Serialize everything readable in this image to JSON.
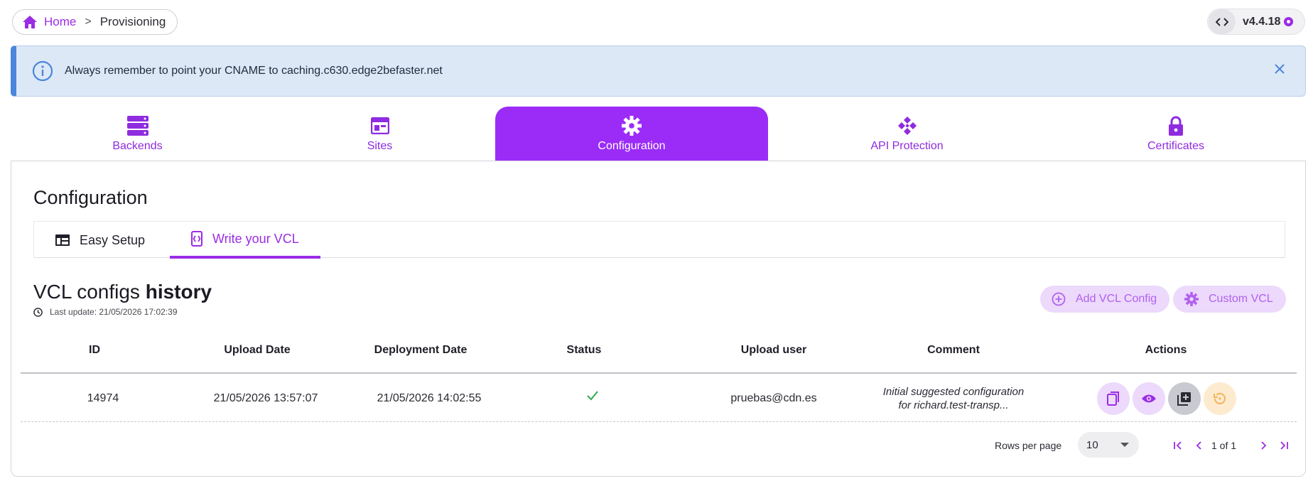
{
  "breadcrumb": {
    "home": "Home",
    "separator": ">",
    "current": "Provisioning"
  },
  "version": {
    "label": "v4.4.18"
  },
  "alert": {
    "text": "Always remember to point your CNAME to caching.c630.edge2befaster.net"
  },
  "tabs": [
    {
      "label": "Backends",
      "icon": "server-icon"
    },
    {
      "label": "Sites",
      "icon": "browser-window-icon"
    },
    {
      "label": "Configuration",
      "icon": "gear-icon",
      "active": true
    },
    {
      "label": "API Protection",
      "icon": "api-protection-icon"
    },
    {
      "label": "Certificates",
      "icon": "lock-icon"
    }
  ],
  "section": {
    "title": "Configuration"
  },
  "subtabs": [
    {
      "label": "Easy Setup",
      "icon": "table-layout-icon"
    },
    {
      "label": "Write your VCL",
      "icon": "code-file-icon",
      "active": true
    }
  ],
  "history": {
    "title_light": "VCL configs",
    "title_bold": "history",
    "last_update": "Last update: 21/05/2026 17:02:39"
  },
  "buttons": {
    "add": "Add VCL Config",
    "custom": "Custom VCL"
  },
  "table": {
    "columns": [
      "ID",
      "Upload Date",
      "Deployment Date",
      "Status",
      "Upload user",
      "Comment",
      "Actions"
    ],
    "rows": [
      {
        "id": "14974",
        "upload_date": "21/05/2026 13:57:07",
        "deployment_date": "21/05/2026 14:02:55",
        "status": "deployed",
        "user": "pruebas@cdn.es",
        "comment_line1": "Initial suggested configuration",
        "comment_line2": "for richard.test-transp..."
      }
    ]
  },
  "pagination": {
    "rows_label": "Rows per page",
    "rows_value": "10",
    "page_text": "1 of 1"
  },
  "colors": {
    "accent": "#9b2cf7",
    "alert_bg": "#dde8f7",
    "alert_border": "#4a87dc",
    "success": "#2fa84f"
  }
}
